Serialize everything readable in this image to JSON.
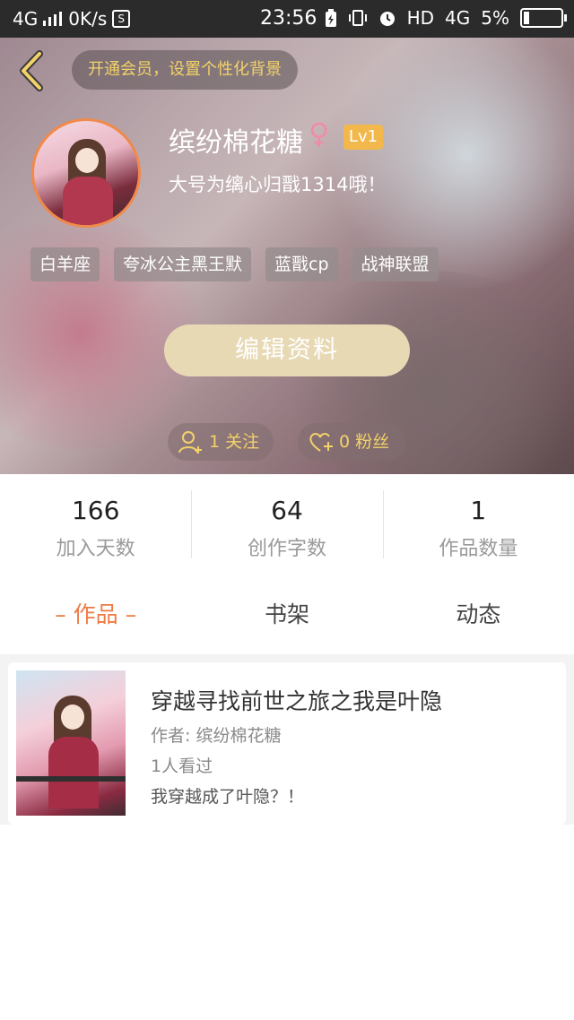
{
  "status_bar": {
    "network": "4G",
    "speed": "0K/s",
    "s_badge": "S",
    "time": "23:56",
    "hd": "HD",
    "network_right": "4G",
    "battery": "5%"
  },
  "header": {
    "vip_banner": "开通会员，设置个性化背景",
    "username": "缤纷棉花糖",
    "gender_symbol": "♀",
    "level": "Lv1",
    "signature": "大号为缡心归戬1314哦！",
    "tags": [
      "白羊座",
      "夸冰公主黑王默",
      "蓝戬cp",
      "战神联盟"
    ],
    "edit_button": "编辑资料",
    "follow_label": "1 关注",
    "fans_label": "0 粉丝"
  },
  "stats": [
    {
      "value": "166",
      "label": "加入天数"
    },
    {
      "value": "64",
      "label": "创作字数"
    },
    {
      "value": "1",
      "label": "作品数量"
    }
  ],
  "tabs": [
    {
      "label": "– 作品 –",
      "active": true
    },
    {
      "label": "书架",
      "active": false
    },
    {
      "label": "动态",
      "active": false
    }
  ],
  "works": [
    {
      "title": "穿越寻找前世之旅之我是叶隐",
      "author": "作者: 缤纷棉花糖",
      "views": "1人看过",
      "description": "我穿越成了叶隐？！"
    }
  ],
  "colors": {
    "accent": "#ee7a43",
    "vip_text": "#f3d26a",
    "level_badge": "#f2b84b",
    "edit_button": "#e8d9b5"
  }
}
